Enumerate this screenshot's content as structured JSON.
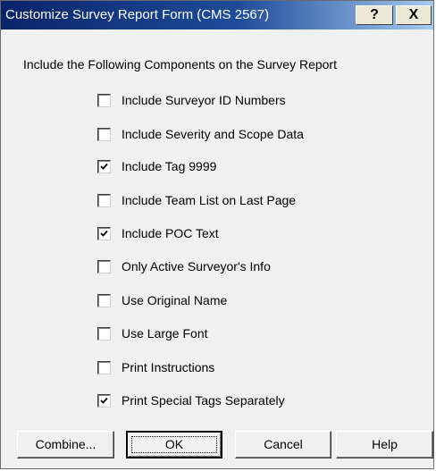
{
  "window": {
    "title": "Customize Survey Report Form (CMS 2567)",
    "help_button": "?",
    "close_button": "X"
  },
  "intro_text": "Include the Following Components on the Survey Report",
  "options": [
    {
      "label": "Include Surveyor ID Numbers",
      "checked": false
    },
    {
      "label": "Include Severity and Scope Data",
      "checked": false
    },
    {
      "label": "Include Tag 9999",
      "checked": true
    },
    {
      "label": "Include Team List on Last Page",
      "checked": false
    },
    {
      "label": "Include POC Text",
      "checked": true
    },
    {
      "label": "Only Active Surveyor's Info",
      "checked": false
    },
    {
      "label": "Use Original Name",
      "checked": false
    },
    {
      "label": "Use Large Font",
      "checked": false
    },
    {
      "label": "Print Instructions",
      "checked": false
    },
    {
      "label": "Print Special Tags Separately",
      "checked": true
    }
  ],
  "buttons": {
    "combine": "Combine...",
    "ok": "OK",
    "cancel": "Cancel",
    "help": "Help"
  },
  "colors": {
    "titlebar_start": "#0a246a",
    "titlebar_end": "#a6caf0",
    "dialog_bg": "#f0f0f0"
  }
}
